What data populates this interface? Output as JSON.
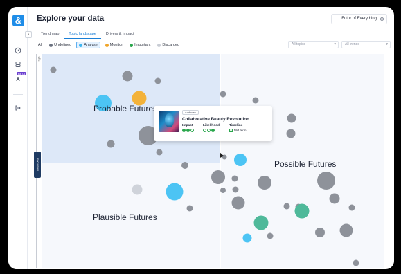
{
  "header": {
    "title": "Explore your data",
    "workspace": "Futur of Everything"
  },
  "rail": {
    "logo": "&",
    "beta_label": "BETA",
    "icons": [
      "dashboard-icon",
      "layers-icon",
      "rocket-icon",
      "logout-icon"
    ]
  },
  "tabs": [
    {
      "label": "Trend map",
      "active": false
    },
    {
      "label": "Topic landscape",
      "active": true
    },
    {
      "label": "Drivers & Impact",
      "active": false
    }
  ],
  "filters": {
    "chips": [
      {
        "label": "All",
        "color": null,
        "active": false
      },
      {
        "label": "Undefined",
        "color": "#6b7280",
        "active": false
      },
      {
        "label": "Analyse",
        "color": "#3fb6f0",
        "active": true
      },
      {
        "label": "Monitor",
        "color": "#f0a52a",
        "active": false
      },
      {
        "label": "Important",
        "color": "#2aa64c",
        "active": false
      },
      {
        "label": "Discarded",
        "color": "#c8ccd4",
        "active": false
      }
    ],
    "topics_select": "All topics",
    "trends_select": "All trends"
  },
  "chart": {
    "y_axis_label": "High",
    "likelihood_tab": "Likelihood",
    "quadrants": {
      "top_left": "Probable Futures",
      "top_right": "Possible Futures",
      "bottom_left": "Plausible Futures"
    },
    "colors": {
      "undefined": "#8e929a",
      "analyse": "#4cc4f4",
      "monitor": "#f3b23a",
      "important": "#4fb99a",
      "discarded": "#cfd3da"
    }
  },
  "tooltip": {
    "add_label": "Add now",
    "title": "Collaborative Beauty Revolution",
    "impact_label": "Impact",
    "likelihood_label": "Likelihood",
    "timeline_label": "Timeline",
    "timeline_value": "Mid term"
  }
}
